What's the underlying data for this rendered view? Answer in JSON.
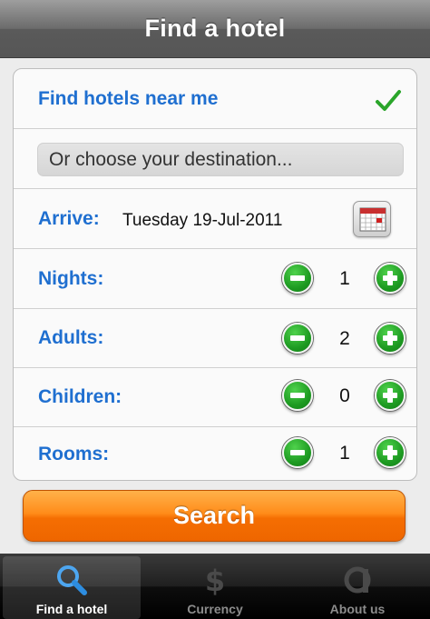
{
  "nav": {
    "title": "Find a hotel"
  },
  "form": {
    "near_me": "Find hotels near me",
    "destination_placeholder": "Or choose your destination...",
    "arrive_label": "Arrive:",
    "arrive_value": "Tuesday 19-Jul-2011",
    "nights_label": "Nights:",
    "nights_value": "1",
    "adults_label": "Adults:",
    "adults_value": "2",
    "children_label": "Children:",
    "children_value": "0",
    "rooms_label": "Rooms:",
    "rooms_value": "1"
  },
  "search_label": "Search",
  "tabs": [
    {
      "label": "Find a hotel",
      "icon": "magnifier-icon",
      "active": true
    },
    {
      "label": "Currency",
      "icon": "dollar-icon",
      "active": false
    },
    {
      "label": "About us",
      "icon": "info-icon",
      "active": false
    }
  ],
  "colors": {
    "label_blue": "#1f6fd0",
    "search_orange": "#ff8c1a",
    "stepper_green": "#1e9b22"
  }
}
